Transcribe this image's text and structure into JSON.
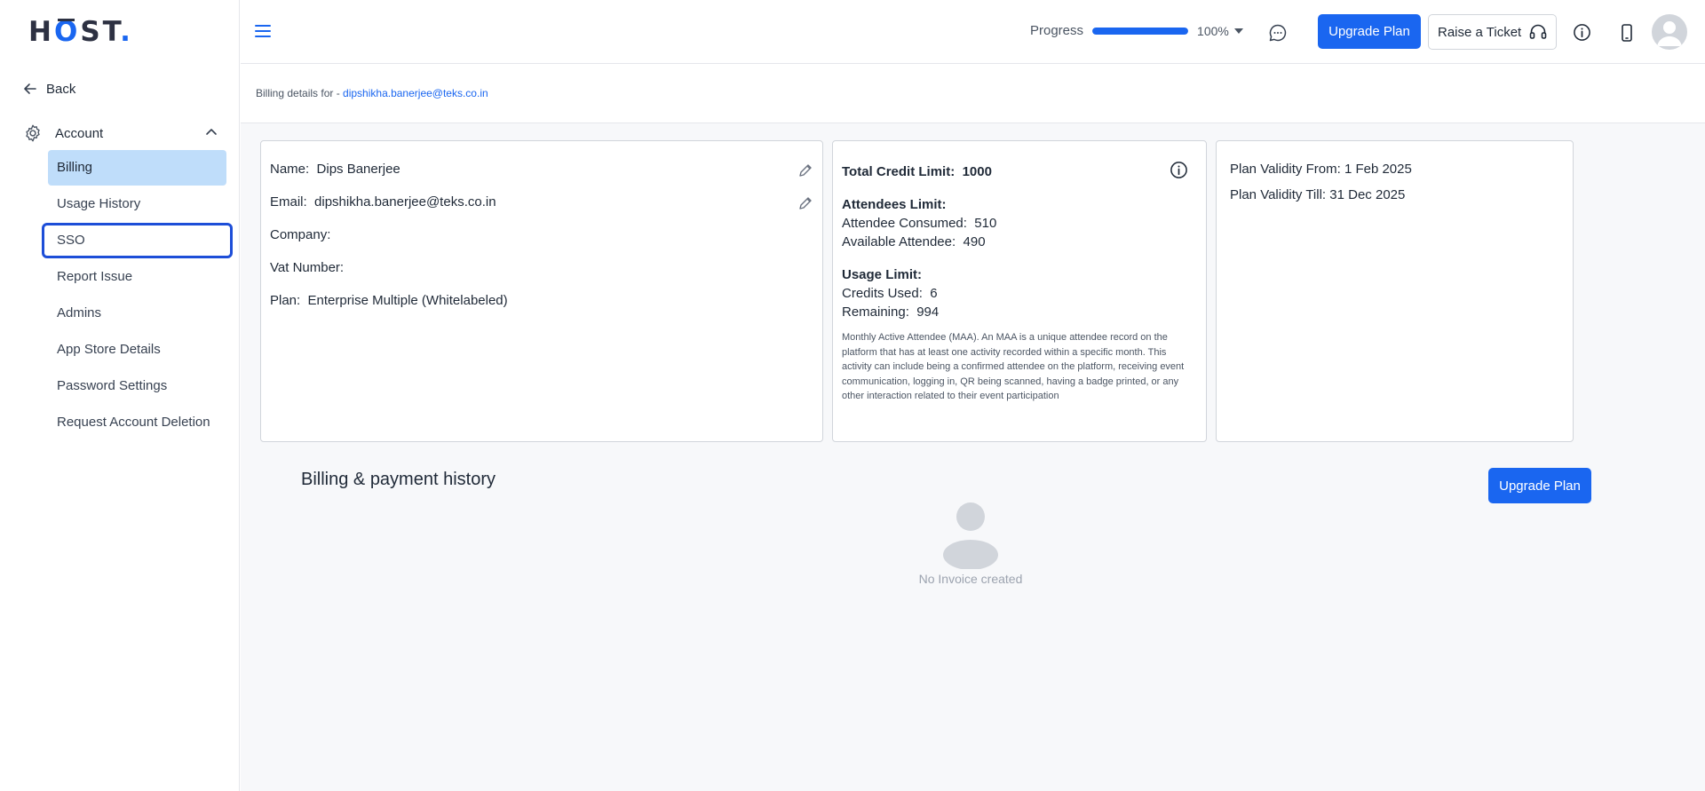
{
  "logo": {
    "pre": "H",
    "o": "O",
    "post": "ST",
    "dot": "."
  },
  "sidebar": {
    "back_label": "Back",
    "section_label": "Account",
    "items": [
      {
        "label": "Billing",
        "active": true
      },
      {
        "label": "Usage History"
      },
      {
        "label": "SSO",
        "focused": true
      },
      {
        "label": "Report Issue"
      },
      {
        "label": "Admins"
      },
      {
        "label": "App Store Details"
      },
      {
        "label": "Password Settings"
      },
      {
        "label": "Request Account Deletion"
      }
    ]
  },
  "topbar": {
    "progress_label": "Progress",
    "progress_value": 1.0,
    "progress_text": "100%",
    "upgrade_label": "Upgrade Plan",
    "ticket_label": "Raise a Ticket"
  },
  "billing_header": {
    "prefix": "Billing details for - ",
    "email": "dipshikha.banerjee@teks.co.in"
  },
  "profile": {
    "name_label": "Name:",
    "name_value": "Dips Banerjee",
    "email_label": "Email:",
    "email_value": "dipshikha.banerjee@teks.co.in",
    "company_label": "Company:",
    "company_value": "",
    "vat_label": "Vat Number:",
    "vat_value": "",
    "plan_label": "Plan:",
    "plan_value": "Enterprise Multiple (Whitelabeled)"
  },
  "limits": {
    "total_credit_label": "Total Credit Limit:",
    "total_credit_value": "1000",
    "attendees_heading": "Attendees Limit:",
    "consumed_label": "Attendee Consumed:",
    "consumed_value": "510",
    "available_label": "Available Attendee:",
    "available_value": "490",
    "usage_heading": "Usage Limit:",
    "credits_used_label": "Credits Used:",
    "credits_used_value": "6",
    "remaining_label": "Remaining:",
    "remaining_value": "994",
    "note": "Monthly Active Attendee (MAA). An MAA is a unique attendee record on the platform that has at least one activity recorded within a specific month. This activity can include being a confirmed attendee on the platform, receiving event communication, logging in, QR being scanned, having a badge printed, or any other interaction related to their event participation"
  },
  "validity": {
    "from_label": "Plan Validity From:",
    "from_value": "1 Feb 2025",
    "till_label": "Plan Validity Till:",
    "till_value": "31 Dec 2025"
  },
  "history": {
    "title": "Billing & payment history",
    "upgrade_label": "Upgrade Plan",
    "empty_text": "No Invoice created"
  },
  "colors": {
    "accent": "#1a66f0",
    "active_item_bg": "#bfddfa",
    "focus_outline": "#1d4ed8"
  },
  "icons": [
    "back-arrow-icon",
    "gear-icon",
    "chevron-up-icon",
    "hamburger-icon",
    "chevron-down-icon",
    "chat-icon",
    "headset-icon",
    "info-icon",
    "phone-icon",
    "user-avatar-icon",
    "edit-pencil-icon"
  ]
}
